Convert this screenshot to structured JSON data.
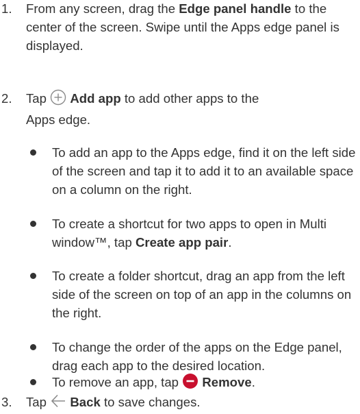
{
  "steps": [
    {
      "number": "1.",
      "text_a": "From any screen, drag the ",
      "bold_a": "Edge panel handle",
      "text_b": " to the center of the screen. Swipe until the Apps edge panel is displayed."
    },
    {
      "number": "2.",
      "text_a": "Tap ",
      "icon": "add-circle-icon",
      "bold_a": "Add app",
      "text_b": " to add other apps to the",
      "text_c": "Apps edge.",
      "bullets": [
        {
          "text_a": "To add an app to the Apps edge, find it on the left side of the screen and tap it to add it to an available space on a column on the right."
        },
        {
          "text_a": "To create a shortcut for two apps to open in Multi window™, tap ",
          "bold_a": "Create app pair",
          "text_b": "."
        },
        {
          "text_a": "To create a folder shortcut, drag an app from the left side of the screen on top of an app in the columns on the right."
        },
        {
          "text_a": "To change the order of the apps on the Edge panel, drag each app to the desired location."
        },
        {
          "text_a": "To remove an app, tap ",
          "icon": "remove-circle-icon",
          "icon_color": "#c8102e",
          "bold_a": "Remove",
          "text_b": "."
        }
      ]
    },
    {
      "number": "3.",
      "text_a": "Tap ",
      "icon": "back-arrow-icon",
      "bold_a": "Back",
      "text_b": " to save changes."
    }
  ]
}
